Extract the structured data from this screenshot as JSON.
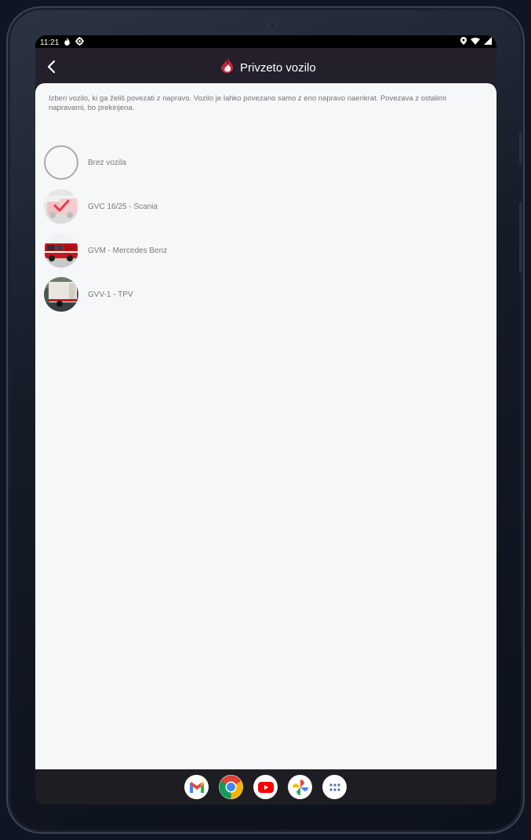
{
  "status": {
    "time": "11:21"
  },
  "appbar": {
    "title": "Privzeto vozilo"
  },
  "info_text": "Izberi vozilo, ki ga želiš povezati z napravo. Vozilo je lahko povezano samo z eno napravo naenkrat. Povezava z ostalimi napravami, bo prekinjena.",
  "vehicles": [
    {
      "label": "Brez vozila",
      "selected": false
    },
    {
      "label": "GVC 16/25 - Scania",
      "selected": true
    },
    {
      "label": "GVM - Mercedes Benz",
      "selected": false
    },
    {
      "label": "GVV-1 - TPV",
      "selected": false
    }
  ],
  "dock": [
    "gmail-icon",
    "chrome-icon",
    "youtube-icon",
    "photos-icon",
    "app-drawer-icon"
  ],
  "colors": {
    "appbar": "#24202b",
    "accent_red": "#e53946",
    "background": "#f6f7f9"
  }
}
